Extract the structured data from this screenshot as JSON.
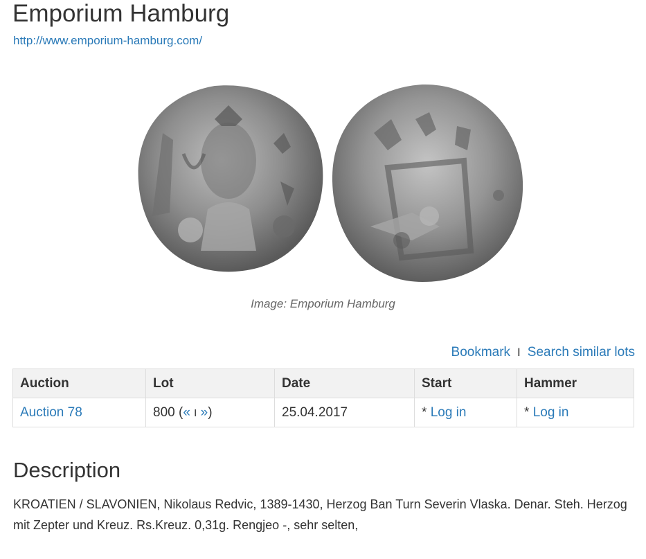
{
  "header": {
    "title": "Emporium Hamburg",
    "url": "http://www.emporium-hamburg.com/"
  },
  "image": {
    "caption": "Image: Emporium Hamburg"
  },
  "actions": {
    "bookmark": "Bookmark",
    "separator": "I",
    "search_similar": "Search similar lots"
  },
  "table": {
    "headers": [
      "Auction",
      "Lot",
      "Date",
      "Start",
      "Hammer"
    ],
    "row": {
      "auction": "Auction 78",
      "lot": "800",
      "lot_open": "(",
      "lot_prev": "«",
      "lot_sep": "I",
      "lot_next": "»",
      "lot_close": ")",
      "date": "25.04.2017",
      "start_prefix": "*",
      "start_link": "Log in",
      "hammer_prefix": "*",
      "hammer_link": "Log in"
    }
  },
  "description": {
    "heading": "Description",
    "text": "KROATIEN / SLAVONIEN, Nikolaus Redvic, 1389-1430, Herzog Ban Turn Severin Vlaska. Denar. Steh. Herzog mit Zepter und Kreuz. Rs.Kreuz. 0,31g. Rengjeo -, sehr selten,"
  },
  "colors": {
    "link": "#2a7ab8",
    "text": "#333333",
    "table_header_bg": "#f2f2f2"
  }
}
